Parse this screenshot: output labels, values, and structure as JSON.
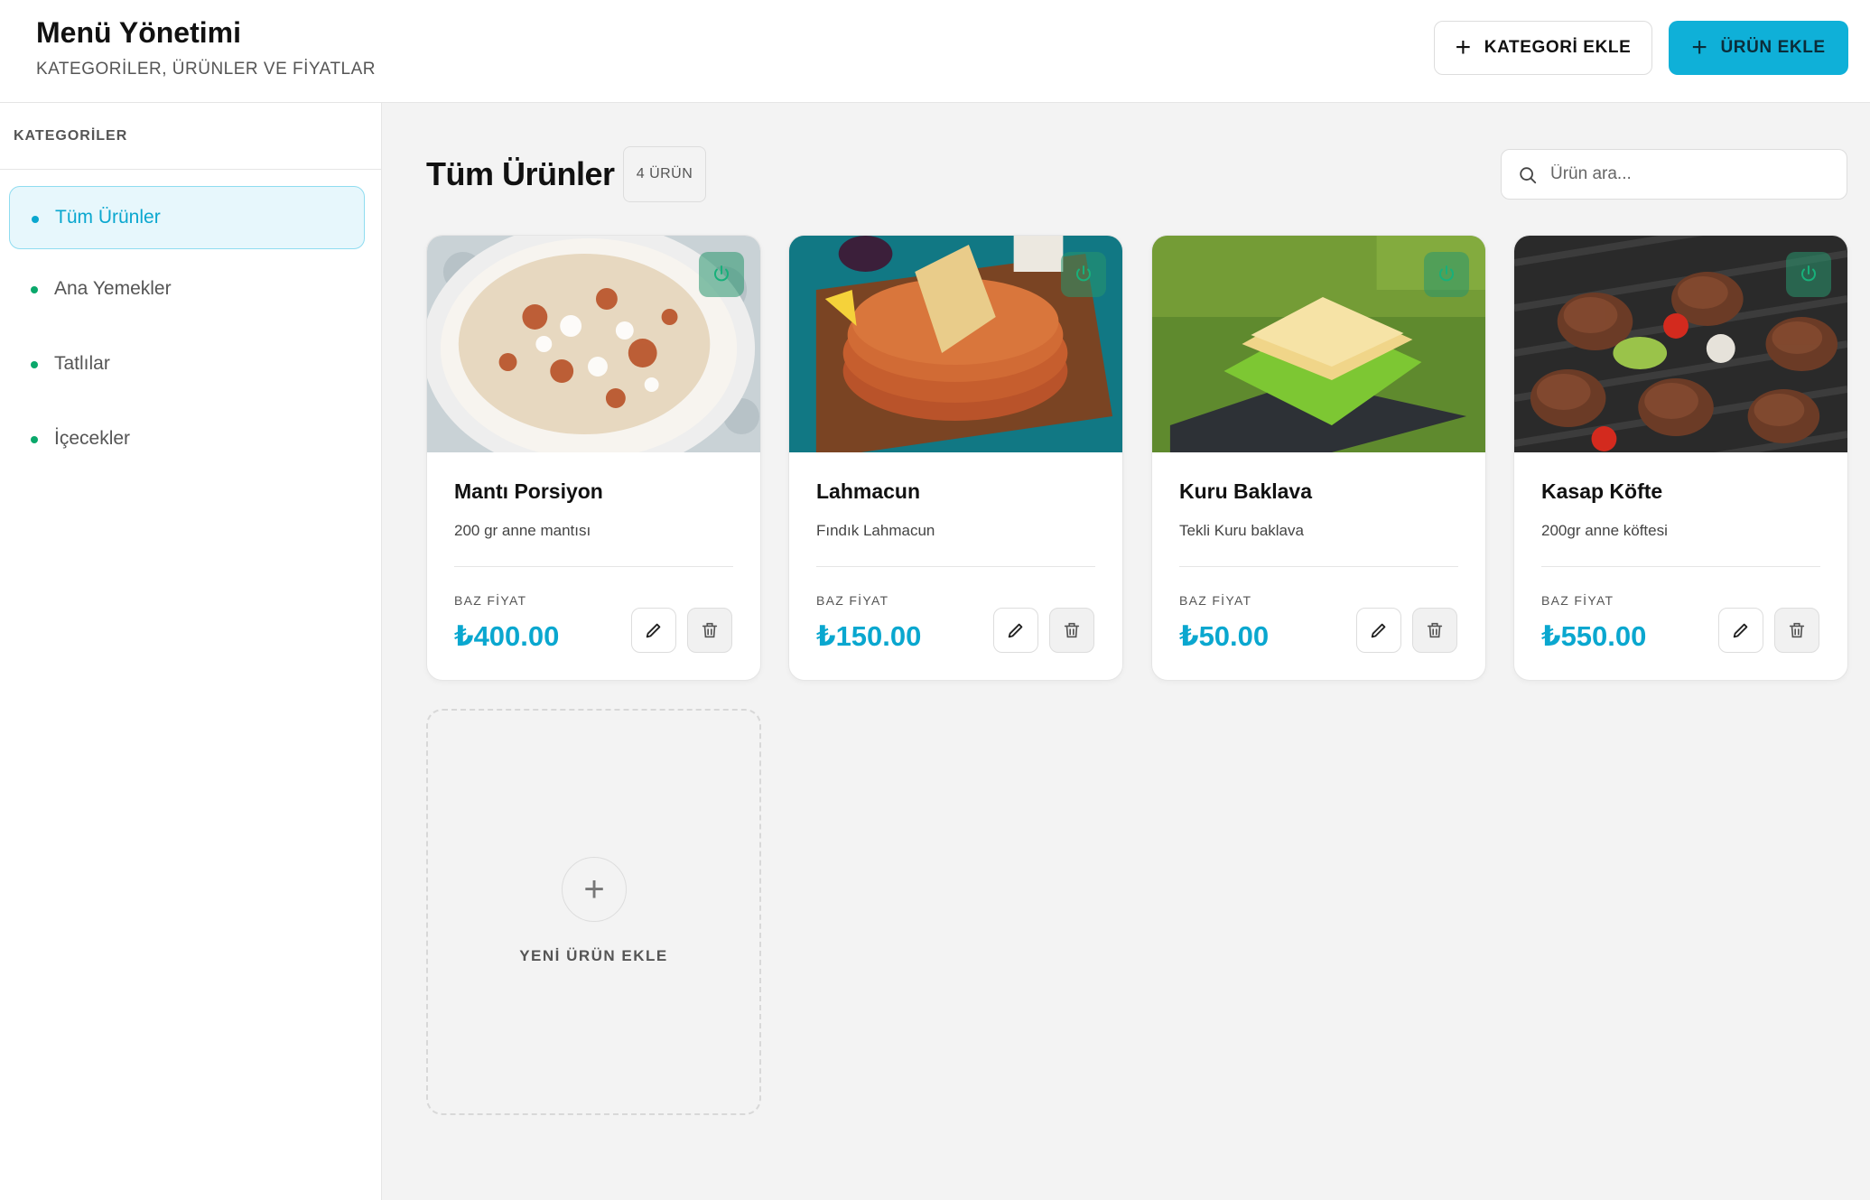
{
  "header": {
    "title": "Menü Yönetimi",
    "subtitle": "KATEGORİLER, ÜRÜNLER VE FİYATLAR",
    "add_category_label": "KATEGORİ EKLE",
    "add_product_label": "ÜRÜN EKLE"
  },
  "sidebar": {
    "heading": "KATEGORİLER",
    "items": [
      {
        "label": "Tüm Ürünler",
        "active": true
      },
      {
        "label": "Ana Yemekler",
        "active": false
      },
      {
        "label": "Tatlılar",
        "active": false
      },
      {
        "label": "İçecekler",
        "active": false
      }
    ]
  },
  "main": {
    "title": "Tüm Ürünler",
    "count_badge": "4 ÜRÜN",
    "search_placeholder": "Ürün ara...",
    "price_label": "BAZ FİYAT",
    "products": [
      {
        "name": "Mantı Porsiyon",
        "description": "200 gr anne mantısı",
        "price": "₺400.00",
        "icon": "manti-image"
      },
      {
        "name": "Lahmacun",
        "description": "Fındık Lahmacun",
        "price": "₺150.00",
        "icon": "lahmacun-image"
      },
      {
        "name": "Kuru Baklava",
        "description": "Tekli Kuru baklava",
        "price": "₺50.00",
        "icon": "baklava-image"
      },
      {
        "name": "Kasap Köfte",
        "description": "200gr anne köftesi",
        "price": "₺550.00",
        "icon": "kofte-image"
      }
    ],
    "add_new_label": "YENİ ÜRÜN EKLE"
  },
  "colors": {
    "accent": "#0fb0d8",
    "price": "#0aa7cf",
    "active_bg": "#e7f7fc",
    "dot": "#0aa86b",
    "power": "#28966e"
  }
}
